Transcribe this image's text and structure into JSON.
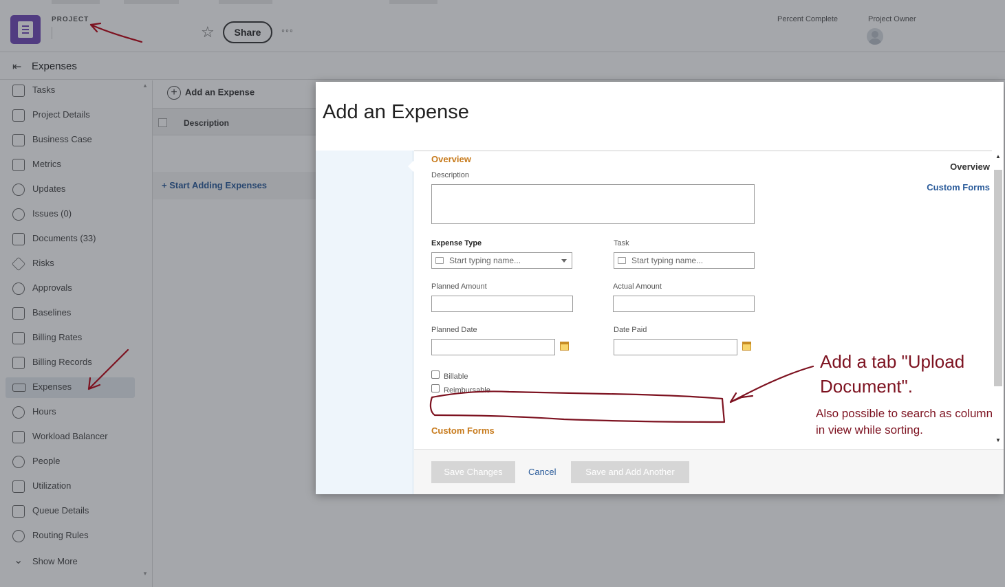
{
  "topbar": {
    "project_label": "PROJECT",
    "share_label": "Share",
    "more_glyph": "◦◦◦",
    "star_glyph": "☆",
    "percent_complete_label": "Percent Complete",
    "project_owner_label": "Project Owner"
  },
  "section": {
    "title": "Expenses",
    "collapse_glyph": "⇤"
  },
  "sidebar": {
    "items": [
      {
        "label": "Tasks",
        "icon": "tasks-icon"
      },
      {
        "label": "Project Details",
        "icon": "document-icon"
      },
      {
        "label": "Business Case",
        "icon": "business-case-icon"
      },
      {
        "label": "Metrics",
        "icon": "metrics-icon"
      },
      {
        "label": "Updates",
        "icon": "chat-icon"
      },
      {
        "label": "Issues (0)",
        "icon": "issue-icon"
      },
      {
        "label": "Documents (33)",
        "icon": "file-icon"
      },
      {
        "label": "Risks",
        "icon": "risk-icon"
      },
      {
        "label": "Approvals",
        "icon": "check-circle-icon"
      },
      {
        "label": "Baselines",
        "icon": "baseline-icon"
      },
      {
        "label": "Billing Rates",
        "icon": "billing-rates-icon"
      },
      {
        "label": "Billing Records",
        "icon": "billing-records-icon"
      },
      {
        "label": "Expenses",
        "icon": "money-icon",
        "active": true
      },
      {
        "label": "Hours",
        "icon": "clock-icon"
      },
      {
        "label": "Workload Balancer",
        "icon": "calendar-icon"
      },
      {
        "label": "People",
        "icon": "people-icon"
      },
      {
        "label": "Utilization",
        "icon": "chart-icon"
      },
      {
        "label": "Queue Details",
        "icon": "queue-icon"
      },
      {
        "label": "Routing Rules",
        "icon": "routing-icon"
      }
    ],
    "show_more": "Show More"
  },
  "expenses_page": {
    "add_expense": "Add an Expense",
    "column_description": "Description",
    "start_adding": "+ Start Adding Expenses"
  },
  "modal": {
    "title": "Add an Expense",
    "nav": {
      "overview": "Overview",
      "custom_forms": "Custom Forms"
    },
    "overview_heading": "Overview",
    "description_label": "Description",
    "expense_type_label": "Expense Type",
    "expense_type_placeholder": "Start typing name...",
    "task_label": "Task",
    "task_placeholder": "Start typing name...",
    "planned_amount_label": "Planned Amount",
    "actual_amount_label": "Actual Amount",
    "planned_date_label": "Planned Date",
    "date_paid_label": "Date Paid",
    "billable_label": "Billable",
    "reimbursable_label": "Reimbursable",
    "custom_forms_heading": "Custom Forms",
    "footer": {
      "save_changes": "Save Changes",
      "cancel": "Cancel",
      "save_and_add": "Save and Add Another"
    }
  },
  "annotations": {
    "upload_note": "Add a tab \"Upload Document\".",
    "search_note": "Also possible to search as column in view while sorting.",
    "color": "#7d1220"
  }
}
